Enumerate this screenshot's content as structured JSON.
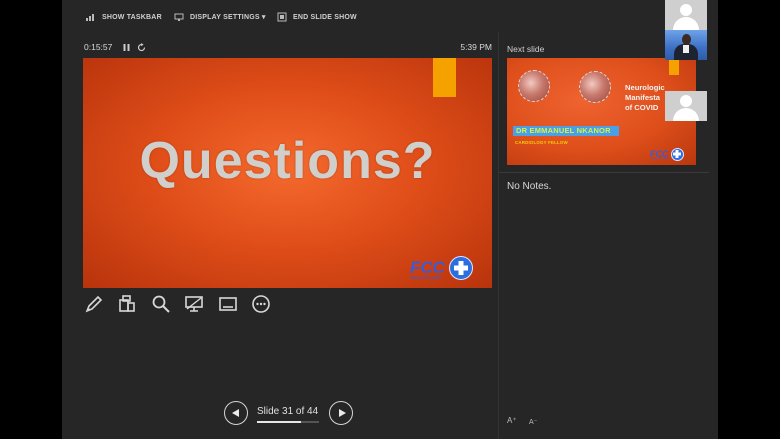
{
  "toolbar": {
    "show_taskbar": "SHOW TASKBAR",
    "display_settings": "DISPLAY SETTINGS ▾",
    "end_slide_show": "END SLIDE SHOW"
  },
  "timer": {
    "elapsed": "0:15:57",
    "clock": "5:39 PM"
  },
  "current_slide": {
    "text": "Questions?",
    "logo_text": "FCC",
    "logo_subtext": "HEALTHCARE"
  },
  "next_slide": {
    "label": "Next slide",
    "title": "Neurologic\nManifesta\nof COVID",
    "presenter_name": "DR EMMANUEL NKANOR",
    "presenter_role": "CARDIOLOGY FELLOW",
    "logo_text": "FCC",
    "logo_subtext": "HEALTHCARE"
  },
  "notes": {
    "text": "No Notes.",
    "font_increase": "A⁺",
    "font_decrease": "A⁻"
  },
  "navigation": {
    "counter": "Slide 31 of 44",
    "current": 31,
    "total": 44
  },
  "colors": {
    "slide_orange": "#e04e19",
    "accent_block": "#f5a200",
    "logo_blue": "#2a6ee0",
    "background": "#262626"
  },
  "icons": [
    "pen-icon",
    "slides-grid-icon",
    "zoom-icon",
    "pointer-screen-icon",
    "subtitles-icon",
    "more-options-icon"
  ]
}
